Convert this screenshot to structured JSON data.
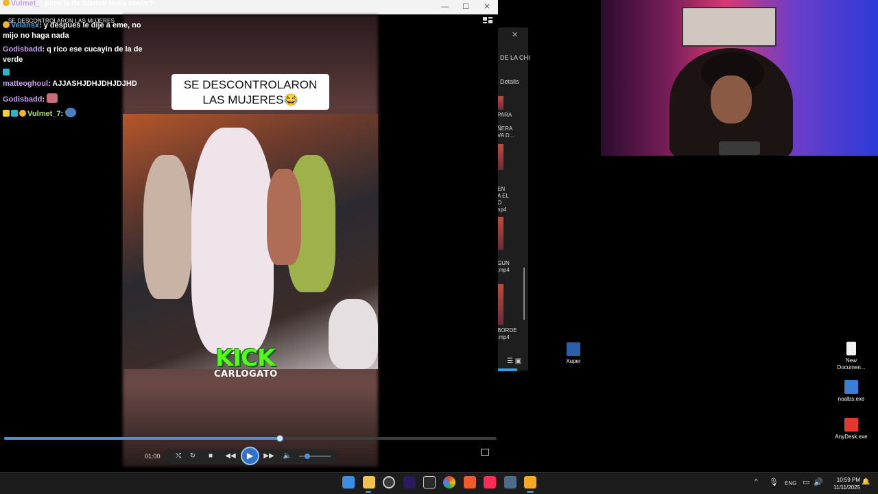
{
  "player": {
    "title": "SE DESCONTROLARON LAS MUJERES",
    "minimize_icon": "minimize-icon",
    "maximize_icon": "maximize-icon",
    "close_icon": "close-icon",
    "caption_line1": "SE DESCONTROLARON",
    "caption_line2": "LAS MUJERES😂",
    "watermark_main": "KICK",
    "watermark_sub": "CARLOGATO",
    "time_elapsed": "01:00",
    "progress": 0.56,
    "volume": 0.25,
    "accent": "#4a90d9"
  },
  "chat": [
    {
      "user": "Vulmet_",
      "text": ": pero la de blanco tenia novio?",
      "color": "#c8a3f0"
    },
    {
      "user": "Velansx",
      "text": ": y despues le dije a eme, no mijo no haga nada",
      "color": "#4aa3df"
    },
    {
      "user": "Godisbadd",
      "text": ": q rico ese cucayin de la de verde",
      "color": "#c8a3f0"
    },
    {
      "user": "matteoghoul",
      "text": ": AJJASHJDHJDHJDJHD",
      "color": "#c8a3f0"
    },
    {
      "user": "Godisbadd",
      "text": ":",
      "color": "#c8a3f0"
    },
    {
      "user": "Vulmet_7",
      "text": ":",
      "color": "#a9e36d"
    }
  ],
  "explorer": {
    "path_fragment": "DE LA CHI",
    "details_label": "Details",
    "files": [
      {
        "label": "PARA"
      },
      {
        "label": "ÑERA\nVA D..."
      },
      {
        "label": "EN\nA EL\nO\nnp4"
      },
      {
        "label": "GUN\n.mp4"
      },
      {
        "label": "BORDE\n.mp4"
      }
    ]
  },
  "desktop_icons": [
    {
      "label": "Xuper"
    },
    {
      "label": "New\nDocumen..."
    },
    {
      "label": "noalbs.exe"
    },
    {
      "label": "AnyDesk.exe"
    }
  ],
  "taskbar": {
    "apps": [
      "windows-start-icon",
      "file-explorer-icon",
      "obs-icon",
      "premiere-icon",
      "epic-games-icon",
      "chromium-icon",
      "brave-icon",
      "tiktok-icon",
      "calculator-icon",
      "media-player-icon"
    ],
    "tray": {
      "language": "ENG",
      "time": "10:59 PM",
      "date": "11/11/2025"
    }
  }
}
